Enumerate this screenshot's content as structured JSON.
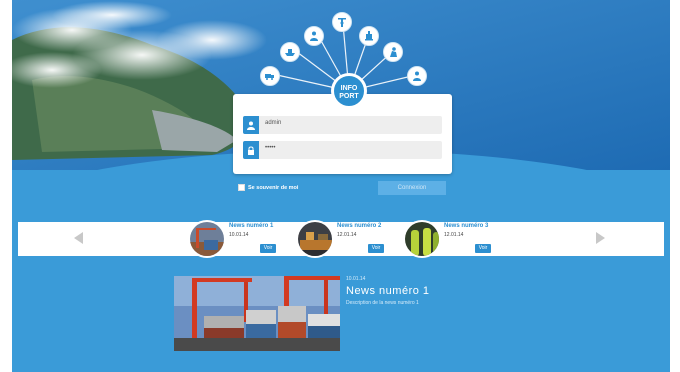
{
  "login": {
    "username_value": "admin",
    "password_value": "•••••",
    "remember_label": "Se souvenir de moi",
    "connect_label": "Connexion",
    "logo_line1": "INFO",
    "logo_line2": "PORT"
  },
  "hub_icons": [
    "truck-icon",
    "person-icon",
    "ship-icon",
    "crane-icon",
    "forklift-icon",
    "worker-icon",
    "person-group-icon"
  ],
  "news": [
    {
      "title": "News numéro 1",
      "date": "10.01.14",
      "button": "Voir"
    },
    {
      "title": "News numéro 2",
      "date": "12.01.14",
      "button": "Voir"
    },
    {
      "title": "News numéro 3",
      "date": "12.01.14",
      "button": "Voir"
    }
  ],
  "featured": {
    "date": "10.01.14",
    "title": "News numéro 1",
    "description": "Description de la news numéro 1"
  },
  "colors": {
    "accent": "#2c8fd0",
    "background": "#3a9bd8"
  }
}
